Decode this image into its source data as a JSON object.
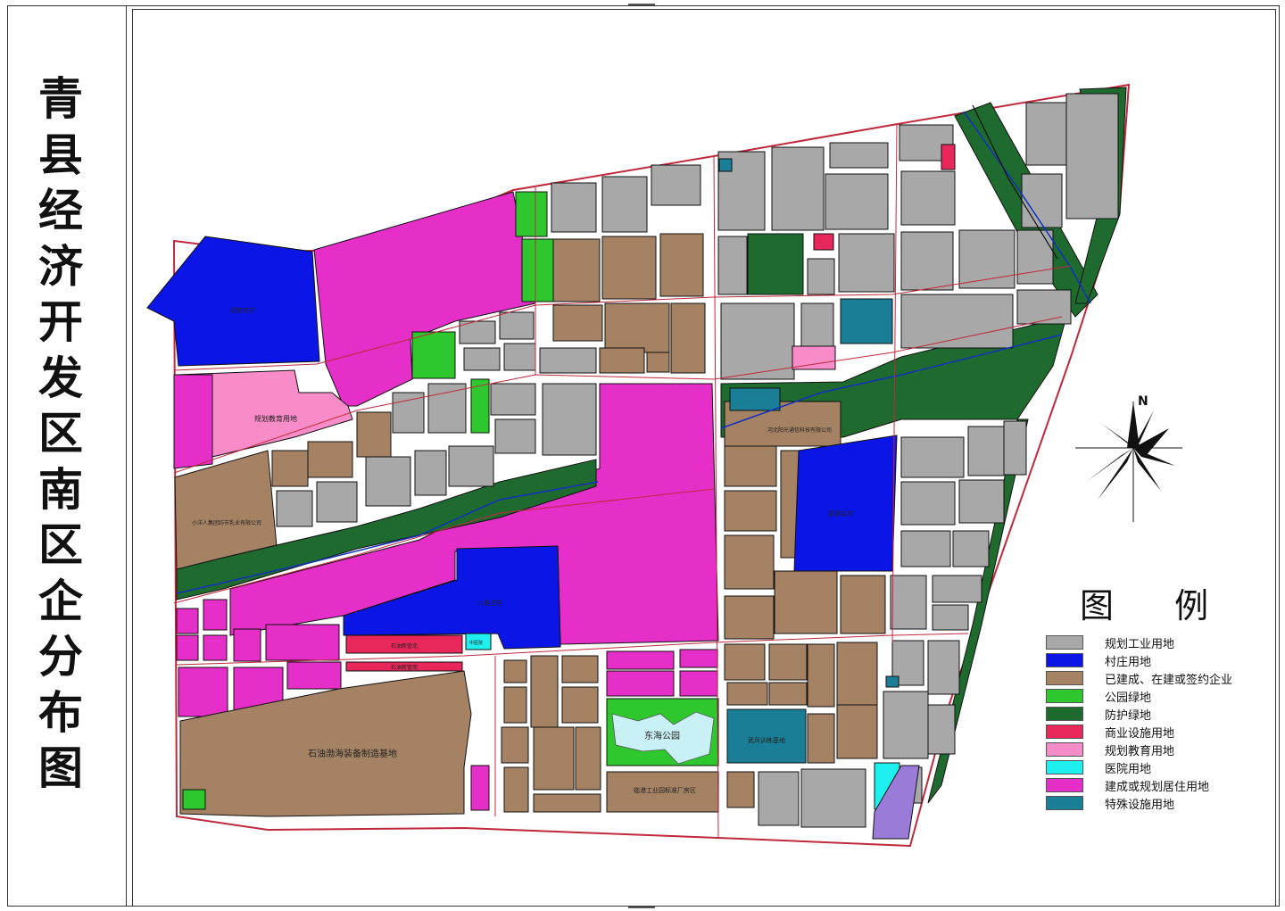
{
  "title": [
    "青",
    "县",
    "经",
    "济",
    "开",
    "发",
    "区",
    "南",
    "区",
    "企",
    "分",
    "布",
    "图"
  ],
  "north_label": "N",
  "legend": {
    "title": "图 例",
    "items": [
      {
        "label": "规划工业用地",
        "color": "#a8a8a8"
      },
      {
        "label": "村庄用地",
        "color": "#0b16e6"
      },
      {
        "label": "已建成、在建或签约企业",
        "color": "#a58264"
      },
      {
        "label": "公园绿地",
        "color": "#2ec82e"
      },
      {
        "label": "防护绿地",
        "color": "#1f6b2f"
      },
      {
        "label": "商业设施用地",
        "color": "#e8285a"
      },
      {
        "label": "规划教育用地",
        "color": "#f78cc8"
      },
      {
        "label": "医院用地",
        "color": "#1ef0f0"
      },
      {
        "label": "建成或规划居住用地",
        "color": "#e62ec8"
      },
      {
        "label": "特殊设施用地",
        "color": "#1a7f96"
      }
    ]
  },
  "areas": {
    "village_nw": "胡官屯村",
    "education_w": "规划教育用地",
    "xiaoyang": "小洋人集团纺市乳业有限公司",
    "village_center": "八里庄村",
    "village_east": "邵家店村",
    "oil_base": "石油渤海装备制造基地",
    "donghai_park": "东海公园",
    "wuzhuang_base": "武兵训练基地",
    "standard_factory": "临港工业园标准厂房区",
    "hospital_label": "中医院",
    "commercial_a": "石油新管北",
    "commercial_b": "石油新管南",
    "company_north": "河北阳光通信科技有限公司"
  }
}
